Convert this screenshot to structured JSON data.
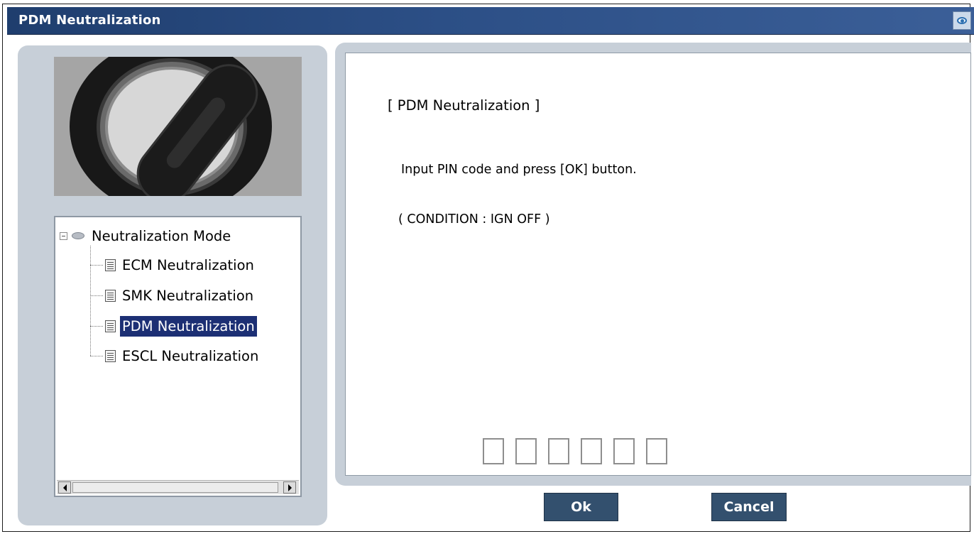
{
  "window": {
    "title": "PDM Neutralization",
    "title_icon": "eye-icon"
  },
  "tree": {
    "root": {
      "label": "Neutralization Mode",
      "icon": "disc-icon",
      "expanded": true
    },
    "items": [
      {
        "label": "ECM Neutralization",
        "icon": "document-icon",
        "selected": false
      },
      {
        "label": "SMK Neutralization",
        "icon": "document-icon",
        "selected": false
      },
      {
        "label": "PDM Neutralization",
        "icon": "document-icon",
        "selected": true
      },
      {
        "label": "ESCL Neutralization",
        "icon": "document-icon",
        "selected": false
      }
    ],
    "selected_color": "#1c2f74"
  },
  "content": {
    "heading": "[ PDM Neutralization ]",
    "instruction": "Input PIN code and press [OK] button.",
    "condition": "( CONDITION : IGN OFF )",
    "pin_values": [
      "",
      "",
      "",
      "",
      "",
      ""
    ]
  },
  "buttons": {
    "ok": "Ok",
    "cancel": "Cancel"
  },
  "colors": {
    "titlebar": "#2c4f86",
    "panel": "#c7cfd8",
    "button": "#33506e"
  }
}
